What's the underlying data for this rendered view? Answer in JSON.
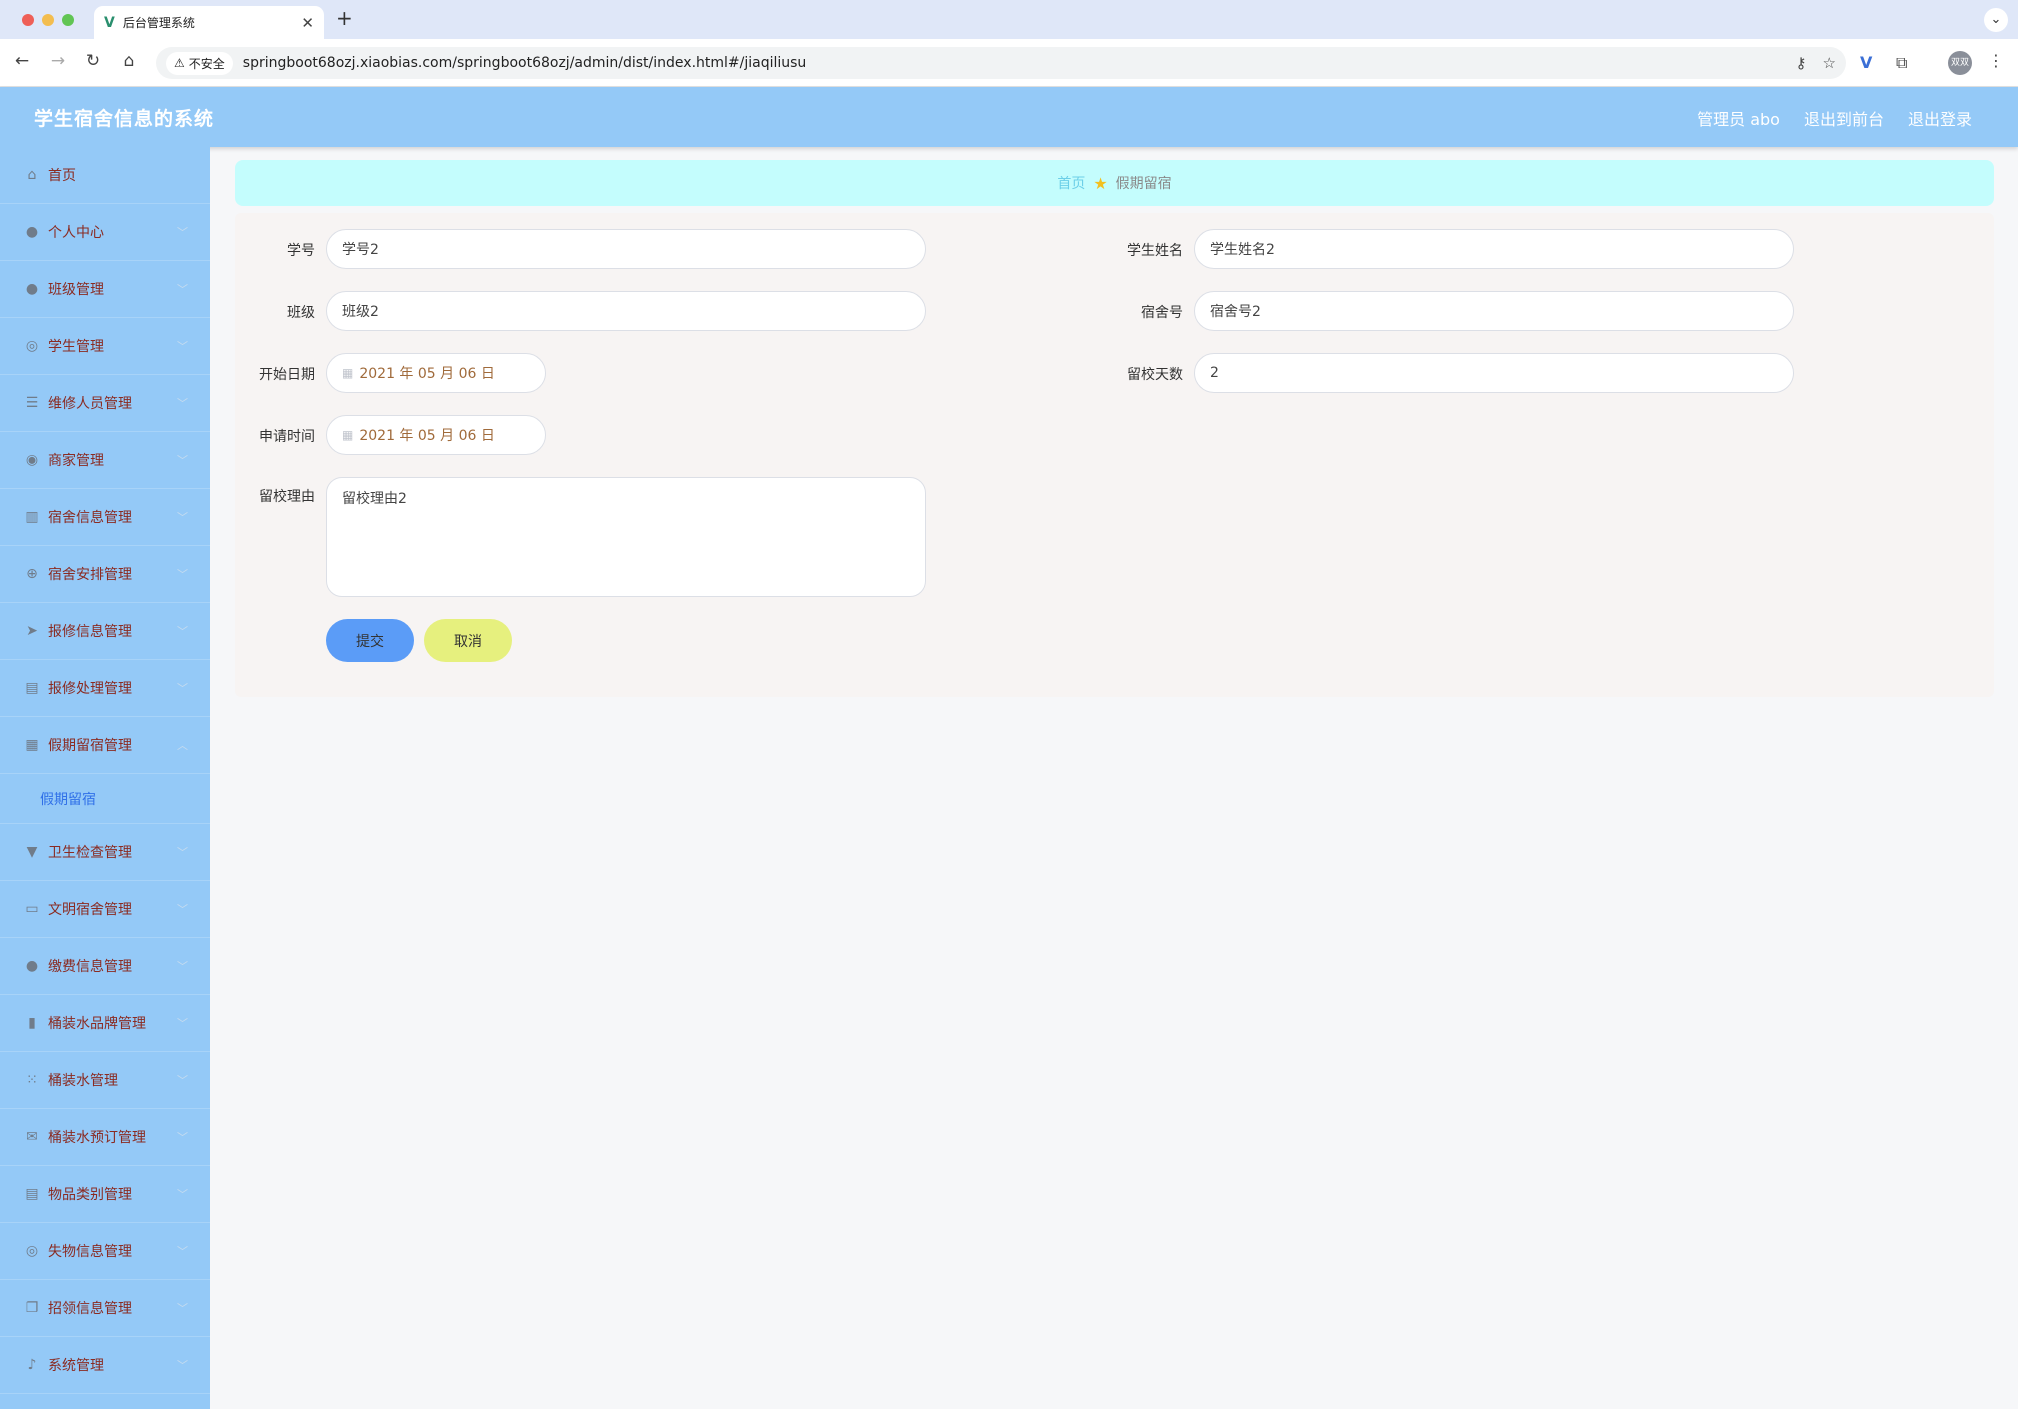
{
  "browser": {
    "tab_title": "后台管理系统",
    "tab_favicon": "V",
    "insecure_label": "不安全",
    "url": "springboot68ozj.xiaobias.com/springboot68ozj/admin/dist/index.html#/jiaqiliusu",
    "profile_text": "双双"
  },
  "header": {
    "title": "学生宿舍信息的系统",
    "user_label": "管理员 abo",
    "front_link": "退出到前台",
    "logout_link": "退出登录"
  },
  "sidebar": {
    "items": [
      {
        "label": "首页",
        "icon": "home-icon"
      },
      {
        "label": "个人中心",
        "icon": "user-icon"
      },
      {
        "label": "班级管理",
        "icon": "user-icon"
      },
      {
        "label": "学生管理",
        "icon": "compass-icon"
      },
      {
        "label": "维修人员管理",
        "icon": "sliders-icon"
      },
      {
        "label": "商家管理",
        "icon": "circle-icon"
      },
      {
        "label": "宿舍信息管理",
        "icon": "building-icon"
      },
      {
        "label": "宿舍安排管理",
        "icon": "target-icon"
      },
      {
        "label": "报修信息管理",
        "icon": "send-icon"
      },
      {
        "label": "报修处理管理",
        "icon": "clipboard-icon"
      },
      {
        "label": "假期留宿管理",
        "icon": "grid-icon"
      },
      {
        "label": "卫生检查管理",
        "icon": "brush-icon"
      },
      {
        "label": "文明宿舍管理",
        "icon": "monitor-icon"
      },
      {
        "label": "缴费信息管理",
        "icon": "user-icon"
      },
      {
        "label": "桶装水品牌管理",
        "icon": "bar-chart-icon"
      },
      {
        "label": "桶装水管理",
        "icon": "apps-icon"
      },
      {
        "label": "桶装水预订管理",
        "icon": "mail-icon"
      },
      {
        "label": "物品类别管理",
        "icon": "clipboard-icon"
      },
      {
        "label": "失物信息管理",
        "icon": "compass-icon"
      },
      {
        "label": "招领信息管理",
        "icon": "copy-icon"
      },
      {
        "label": "系统管理",
        "icon": "mic-icon"
      }
    ],
    "active_sub": "假期留宿"
  },
  "breadcrumb": {
    "home": "首页",
    "current": "假期留宿"
  },
  "form": {
    "student_no_label": "学号",
    "student_no_value": "学号2",
    "student_name_label": "学生姓名",
    "student_name_value": "学生姓名2",
    "class_label": "班级",
    "class_value": "班级2",
    "dorm_no_label": "宿舍号",
    "dorm_no_value": "宿舍号2",
    "start_date_label": "开始日期",
    "start_date_value": "2021 年 05 月 06 日",
    "days_label": "留校天数",
    "days_value": "2",
    "apply_time_label": "申请时间",
    "apply_time_value": "2021 年 05 月 06 日",
    "reason_label": "留校理由",
    "reason_value": "留校理由2",
    "submit_label": "提交",
    "cancel_label": "取消"
  }
}
